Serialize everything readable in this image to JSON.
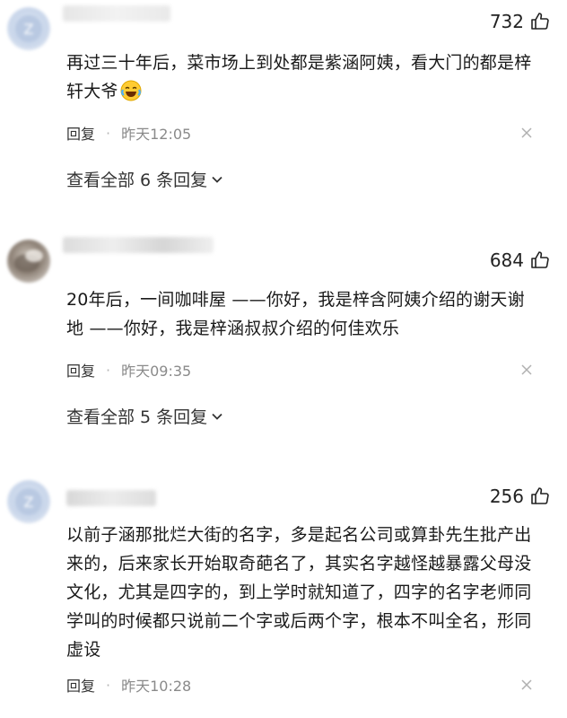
{
  "comments": [
    {
      "likes": "732",
      "text": "再过三十年后，菜市场上到处都是紫涵阿姨，看大门的都是梓轩大爷",
      "reply_label": "回复",
      "separator": "·",
      "time": "昨天12:05",
      "view_all": "查看全部 6 条回复"
    },
    {
      "likes": "684",
      "text": "20年后，一间咖啡屋 ——你好，我是梓含阿姨介绍的谢天谢地 ——你好，我是梓涵叔叔介绍的何佳欢乐",
      "reply_label": "回复",
      "separator": "·",
      "time": "昨天09:35",
      "view_all": "查看全部 5 条回复"
    },
    {
      "likes": "256",
      "text": "以前子涵那批烂大街的名字，多是起名公司或算卦先生批产出来的，后来家长开始取奇葩名了，其实名字越怪越暴露父母没文化，尤其是四字的，到上学时就知道了，四字的名字老师同学叫的时候都只说前二个字或后两个字，根本不叫全名，形同虚设",
      "reply_label": "回复",
      "separator": "·",
      "time": "昨天10:28"
    }
  ],
  "icons": {
    "like": "thumbs-up-icon",
    "close": "close-icon",
    "expand": "chevron-down-icon",
    "emoji": "laughing-crying-emoji"
  }
}
